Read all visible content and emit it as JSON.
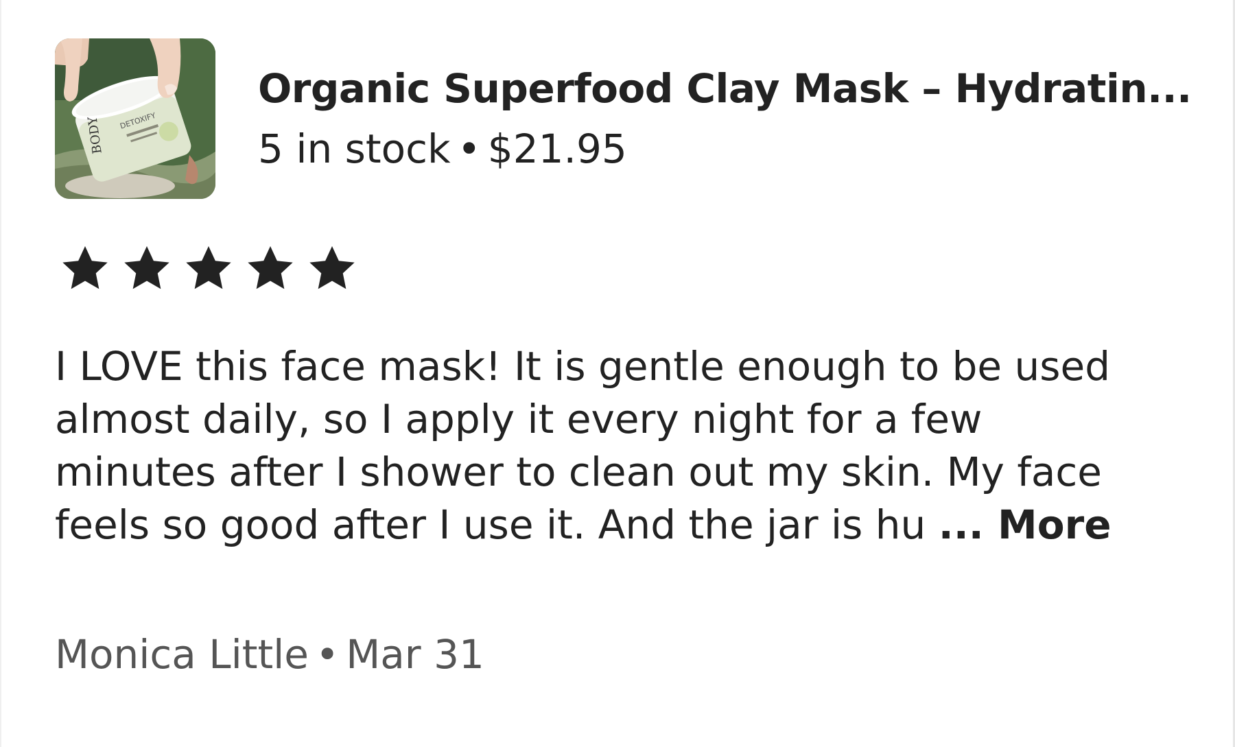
{
  "product": {
    "title": "Organic Superfood Clay Mask – Hydratin...",
    "stock": "5 in stock",
    "separator": "•",
    "price": "$21.95",
    "image_icon": "product-thumbnail",
    "jar_label_brand": "BODY",
    "jar_label_name": "DETOXIFY"
  },
  "review": {
    "rating": 5,
    "max_rating": 5,
    "star_color": "#222222",
    "text": "I LOVE this face mask! It is gentle enough to be used\nalmost daily, so I apply it every night for a few\nminutes after I shower to clean out my skin. My face\nfeels so good after I use it. And the jar is hu",
    "ellipsis": "...",
    "more_label": "More"
  },
  "footer": {
    "author": "Monica Little",
    "separator": "•",
    "date": "Mar 31"
  }
}
